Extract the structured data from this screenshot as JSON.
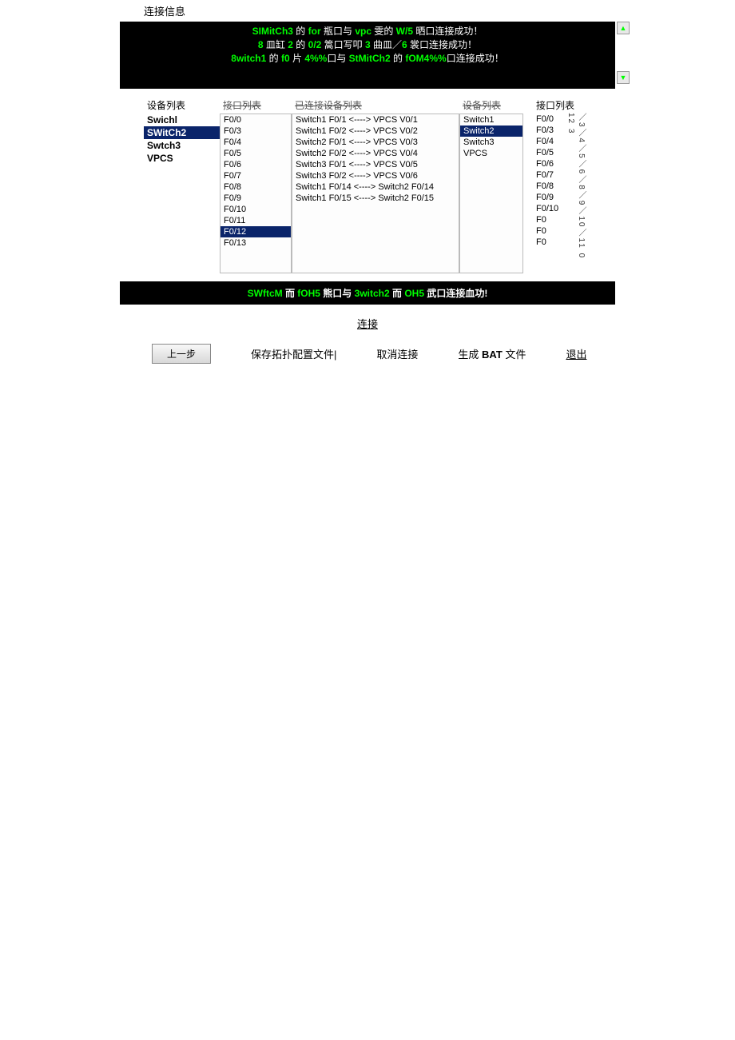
{
  "labels": {
    "connection_info": "连接信息",
    "device_list": "设备列表",
    "port_list": "接口列表",
    "connected_list": "已连接设备列表",
    "device_list_right": "设备列表",
    "port_list_right": "接口列表",
    "connect": "连接",
    "prev": "上一步",
    "save_topo": "保存拓扑配置文件|",
    "cancel_conn": "取消连接",
    "gen_bat_prefix": "生成 ",
    "gen_bat_bold": "BAT",
    "gen_bat_suffix": " 文件",
    "exit": "退出"
  },
  "log": [
    {
      "parts": [
        {
          "t": "SIMitCh3",
          "c": "green"
        },
        {
          "t": " 的 ",
          "c": "white"
        },
        {
          "t": "for",
          "c": "green"
        },
        {
          "t": " 瓶口与 ",
          "c": "white"
        },
        {
          "t": "vpc",
          "c": "green"
        },
        {
          "t": " 雯的 ",
          "c": "white"
        },
        {
          "t": "W/5",
          "c": "green"
        },
        {
          "t": " 晒口连接成功！",
          "c": "white"
        }
      ]
    },
    {
      "parts": [
        {
          "t": "8",
          "c": "green"
        },
        {
          "t": " 皿缸 ",
          "c": "white"
        },
        {
          "t": "2",
          "c": "green"
        },
        {
          "t": " 的 ",
          "c": "white"
        },
        {
          "t": "0/2",
          "c": "green"
        },
        {
          "t": " 篙口写叩 ",
          "c": "white"
        },
        {
          "t": "3",
          "c": "green"
        },
        {
          "t": " 曲皿／",
          "c": "white"
        },
        {
          "t": "6",
          "c": "green"
        },
        {
          "t": " 裳口连接成功！",
          "c": "white"
        }
      ]
    },
    {
      "parts": [
        {
          "t": "8witch1",
          "c": "green"
        },
        {
          "t": " 的 ",
          "c": "white"
        },
        {
          "t": "f0",
          "c": "green"
        },
        {
          "t": " 片 ",
          "c": "white"
        },
        {
          "t": "4%%",
          "c": "green"
        },
        {
          "t": "口与 ",
          "c": "white"
        },
        {
          "t": "StMitCh2",
          "c": "green"
        },
        {
          "t": " 的 ",
          "c": "white"
        },
        {
          "t": "fOM4%%",
          "c": "green"
        },
        {
          "t": "口连接成功！",
          "c": "white"
        }
      ]
    }
  ],
  "devices_left": [
    {
      "label": "Swichl",
      "selected": false,
      "bold": true
    },
    {
      "label": "SWitCh2",
      "selected": true,
      "bold": true
    },
    {
      "label": "Swtch3",
      "selected": false,
      "bold": true
    },
    {
      "label": "VPCS",
      "selected": false,
      "bold": true
    }
  ],
  "ports_left": [
    {
      "label": "F0/0",
      "selected": false
    },
    {
      "label": "F0/3",
      "selected": false
    },
    {
      "label": "F0/4",
      "selected": false
    },
    {
      "label": "F0/5",
      "selected": false
    },
    {
      "label": "F0/6",
      "selected": false
    },
    {
      "label": "F0/7",
      "selected": false
    },
    {
      "label": "F0/8",
      "selected": false
    },
    {
      "label": "F0/9",
      "selected": false
    },
    {
      "label": "F0/10",
      "selected": false
    },
    {
      "label": "F0/11",
      "selected": false
    },
    {
      "label": "F0/12",
      "selected": true
    },
    {
      "label": "F0/13",
      "selected": false
    }
  ],
  "connected": [
    "Switch1 F0/1 <----> VPCS V0/1",
    "Switch1 F0/2 <----> VPCS V0/2",
    "Switch2 F0/1 <----> VPCS V0/3",
    "Switch2 F0/2 <----> VPCS V0/4",
    "Switch3 F0/1 <----> VPCS V0/5",
    "Switch3 F0/2 <----> VPCS V0/6",
    "Switch1 F0/14 <----> Switch2 F0/14",
    "Switch1 F0/15 <----> Switch2 F0/15"
  ],
  "devices_right": [
    {
      "label": "Switch1",
      "selected": false
    },
    {
      "label": "Switch2",
      "selected": true
    },
    {
      "label": "Switch3",
      "selected": false
    },
    {
      "label": "VPCS",
      "selected": false
    }
  ],
  "ports_right": [
    "F0/0",
    "F0/3",
    "F0/4",
    "F0/5",
    "F0/6",
    "F0/7",
    "F0/8",
    "F0/9",
    "F0/10",
    "F0",
    "F0",
    "F0"
  ],
  "vertical_text": "／3／4／5／6／8／9／10／11 0 12 3",
  "status": {
    "parts": [
      {
        "t": "SWftcM",
        "c": "green"
      },
      {
        "t": " 而 ",
        "c": "white"
      },
      {
        "t": "fOH5",
        "c": "green"
      },
      {
        "t": " 熊口与 ",
        "c": "white"
      },
      {
        "t": "3witch2",
        "c": "green"
      },
      {
        "t": " 而 ",
        "c": "white"
      },
      {
        "t": "OH5",
        "c": "green"
      },
      {
        "t": " 武口连接血功!",
        "c": "white"
      }
    ]
  }
}
